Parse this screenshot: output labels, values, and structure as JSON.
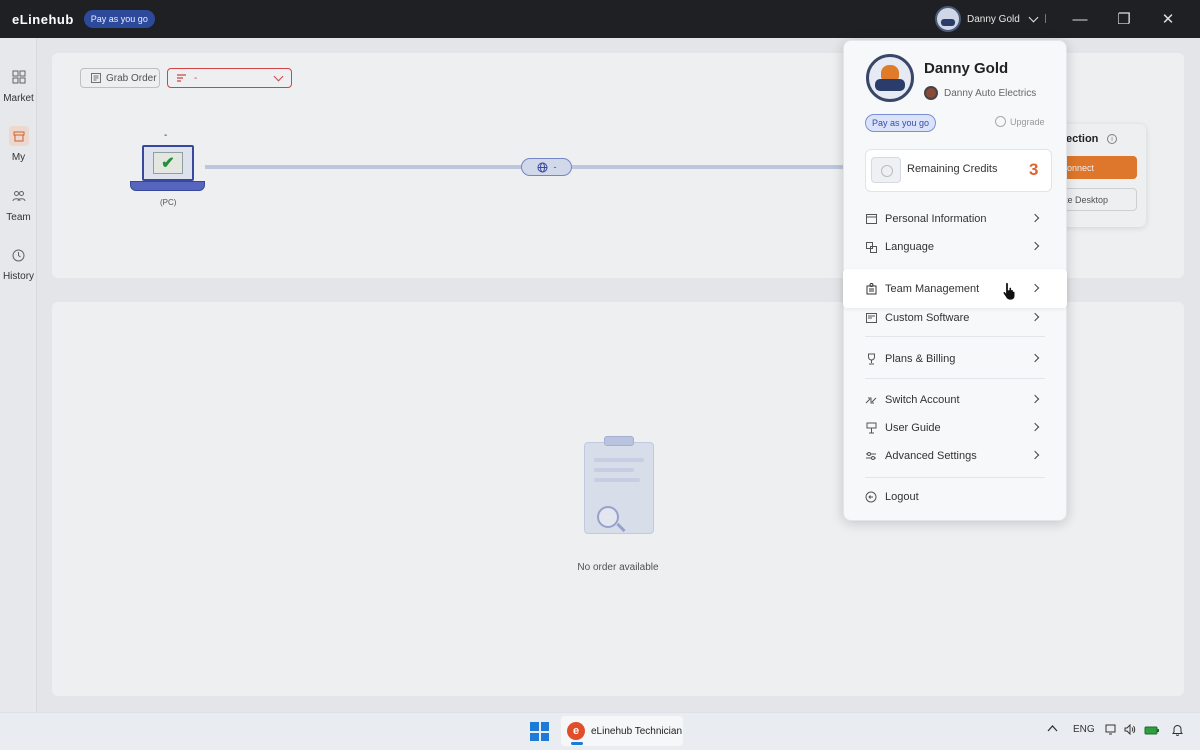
{
  "titlebar": {
    "app_name": "eLinehub",
    "plan_badge": "Pay as you go",
    "user_name": "Danny Gold",
    "minimize": "—",
    "restore": "❐",
    "close": "✕"
  },
  "leftnav": {
    "items": [
      {
        "label": "Market",
        "icon": "grid-icon"
      },
      {
        "label": "My",
        "icon": "box-icon"
      },
      {
        "label": "Team",
        "icon": "team-icon"
      },
      {
        "label": "History",
        "icon": "clock-icon"
      }
    ]
  },
  "toolbar": {
    "grab_order": "Grab Order",
    "filter_value": "-"
  },
  "diagram": {
    "pc_top_label": "-",
    "pc_label": "(PC)",
    "network_label": "-"
  },
  "connection_panel": {
    "title": "ection",
    "connect": "onnect",
    "remote_desktop": "te Desktop"
  },
  "orders": {
    "empty_text": "No order available"
  },
  "profile_menu": {
    "name": "Danny Gold",
    "company": "Danny Auto Electrics",
    "plan": "Pay as you go",
    "upgrade": "Upgrade",
    "credits_label": "Remaining Credits",
    "credits_value": "3",
    "items": [
      {
        "label": "Personal Information"
      },
      {
        "label": "Language"
      },
      {
        "label": "Team Management"
      },
      {
        "label": "Custom Software"
      },
      {
        "label": "Plans & Billing"
      },
      {
        "label": "Switch Account"
      },
      {
        "label": "User Guide"
      },
      {
        "label": "Advanced Settings"
      },
      {
        "label": "Logout"
      }
    ]
  },
  "taskbar": {
    "app_label": "eLinehub Technician",
    "language": "ENG",
    "accent": "#1d7ad6"
  },
  "colors": {
    "brand_orange": "#e0632a",
    "plan_blue": "#2d4a9a",
    "error_red": "#e04545"
  }
}
